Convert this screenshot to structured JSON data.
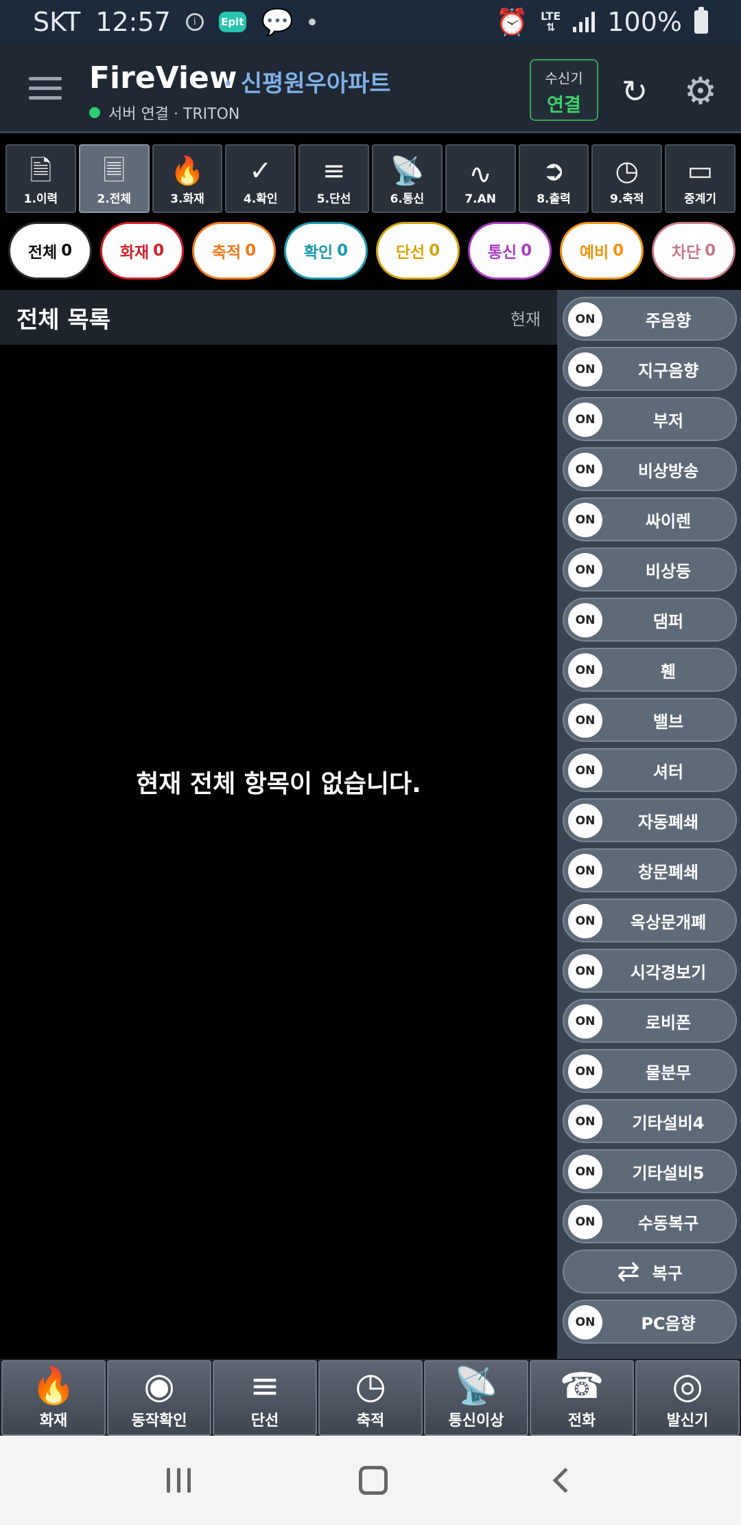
{
  "status_bar": {
    "carrier": "SKT",
    "time": "12:57",
    "app_badge": "Epit",
    "lte": "LTE",
    "battery": "100%"
  },
  "header": {
    "title": "FireView",
    "site": "· 신평원우아파트",
    "server_status": "서버 연결 · TRITON",
    "receiver_top": "수신기",
    "receiver_bottom": "연결"
  },
  "tabs": [
    {
      "label": "1.이력",
      "icon": "document-icon"
    },
    {
      "label": "2.전체",
      "icon": "documents-icon",
      "active": true
    },
    {
      "label": "3.화재",
      "icon": "fire-icon"
    },
    {
      "label": "4.확인",
      "icon": "magnify-check-icon"
    },
    {
      "label": "5.단선",
      "icon": "broken-line-icon"
    },
    {
      "label": "6.통신",
      "icon": "satellite-icon"
    },
    {
      "label": "7.AN",
      "icon": "wave-icon"
    },
    {
      "label": "8.출력",
      "icon": "exit-icon"
    },
    {
      "label": "9.축적",
      "icon": "clock-icon"
    },
    {
      "label": "중계기",
      "icon": "repeater-icon"
    }
  ],
  "filters": [
    {
      "label": "전체",
      "count": "0",
      "color": "#2b2b2b"
    },
    {
      "label": "화재",
      "count": "0",
      "color": "#d0202a"
    },
    {
      "label": "축적",
      "count": "0",
      "color": "#ef7a1a"
    },
    {
      "label": "확인",
      "count": "0",
      "color": "#1a9ab0"
    },
    {
      "label": "단선",
      "count": "0",
      "color": "#d4a50e"
    },
    {
      "label": "통신",
      "count": "0",
      "color": "#a83cc0"
    },
    {
      "label": "예비",
      "count": "0",
      "color": "#f0920f"
    },
    {
      "label": "차단",
      "count": "0",
      "color": "#c47a88"
    }
  ],
  "list": {
    "title": "전체 목록",
    "now_label": "현재",
    "empty_message": "현재 전체 항목이 없습니다."
  },
  "toggles": {
    "knob_label": "ON",
    "items": [
      "주음향",
      "지구음향",
      "부저",
      "비상방송",
      "싸이렌",
      "비상등",
      "댐퍼",
      "휀",
      "밸브",
      "셔터",
      "자동폐쇄",
      "창문폐쇄",
      "옥상문개폐",
      "시각경보기",
      "로비폰",
      "물분무",
      "기타설비4",
      "기타설비5",
      "수동복구"
    ],
    "restore_label": "복구",
    "pc_sound": "PC음향"
  },
  "bottom_bar": [
    {
      "label": "화재",
      "icon": "fire-icon"
    },
    {
      "label": "동작확인",
      "icon": "eye-icon"
    },
    {
      "label": "단선",
      "icon": "broken-line-icon"
    },
    {
      "label": "축적",
      "icon": "clock-icon"
    },
    {
      "label": "통신이상",
      "icon": "satellite-question-icon"
    },
    {
      "label": "전화",
      "icon": "telephone-icon"
    },
    {
      "label": "발신기",
      "icon": "transmitter-icon"
    }
  ],
  "colors": {
    "header_bg": "#1f2833",
    "accent_green": "#3fd06a",
    "site_blue": "#7fb0e6"
  }
}
